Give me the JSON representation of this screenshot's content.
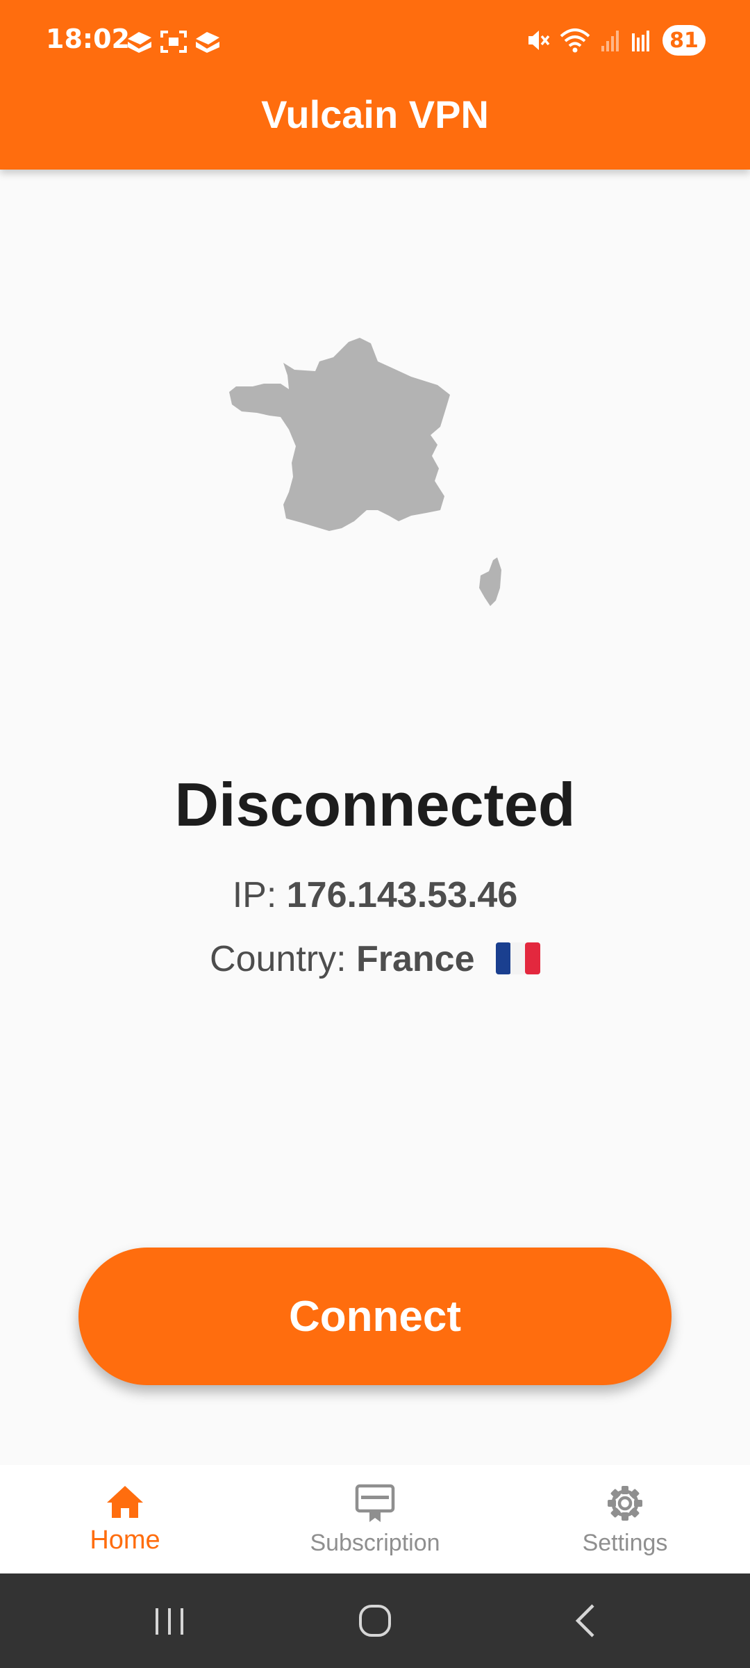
{
  "status_bar": {
    "time": "18:02",
    "battery": "81",
    "icons": [
      "app-notification-icon",
      "screenshot-icon",
      "app-notification-icon",
      "mute-icon",
      "wifi-icon",
      "signal-icon",
      "signal-icon"
    ]
  },
  "header": {
    "title": "Vulcain VPN"
  },
  "map": {
    "icon": "france-map-icon"
  },
  "connection": {
    "status": "Disconnected",
    "ip_label": "IP:",
    "ip_value": "176.143.53.46",
    "country_label": "Country:",
    "country_value": "France",
    "flag_icon": "france-flag-icon"
  },
  "connect_button": {
    "label": "Connect"
  },
  "bottom_nav": {
    "items": [
      {
        "label": "Home",
        "icon": "home-icon",
        "active": true
      },
      {
        "label": "Subscription",
        "icon": "subscription-icon",
        "active": false
      },
      {
        "label": "Settings",
        "icon": "gear-icon",
        "active": false
      }
    ]
  },
  "system_nav": {
    "icons": [
      "recent-apps-icon",
      "home-circle-icon",
      "back-icon"
    ]
  },
  "colors": {
    "accent": "#ff6d0e",
    "background": "#fafafa",
    "map_fill": "#b3b3b3",
    "system_nav_bg": "#333333"
  }
}
